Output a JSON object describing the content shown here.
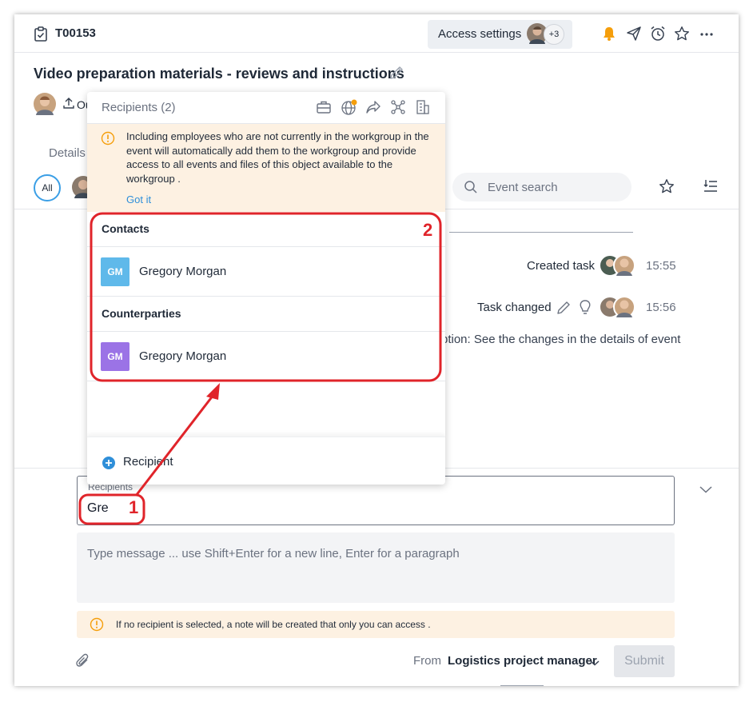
{
  "header": {
    "task_id": "T00153",
    "access_settings_label": "Access settings",
    "access_extra_count": "+3"
  },
  "task": {
    "title": "Video preparation materials - reviews and instructions",
    "owner_text": "Ou",
    "details_tab": "Details"
  },
  "filters": {
    "all_label": "All",
    "search_placeholder": "Event search"
  },
  "events": [
    {
      "label": "Created task",
      "time": "15:55"
    },
    {
      "label": "Task changed",
      "time": "15:56"
    }
  ],
  "event_detail": "ption:  See the changes in the details of event",
  "popup": {
    "title": "Recipients (2)",
    "warning_text": "Including employees who are not currently in the workgroup in the event will automatically add them to the workgroup and provide access to all events and files of this object available to the workgroup .",
    "got_it_label": "Got it",
    "sections": [
      {
        "label": "Contacts",
        "person": {
          "initials": "GM",
          "name": "Gregory Morgan",
          "color": "#5fb9ea"
        }
      },
      {
        "label": "Counterparties",
        "person": {
          "initials": "GM",
          "name": "Gregory Morgan",
          "color": "#9b73e6"
        }
      }
    ],
    "add_recipient_label": "Recipient"
  },
  "compose": {
    "recipients_label": "Recipients",
    "recipients_value": "Gre",
    "message_placeholder": "Type message ... use Shift+Enter for a new line, Enter for a paragraph",
    "note_warning": "If no recipient is selected, a note will be created that only you can access .",
    "from_label": "From",
    "from_value": "Logistics project manager",
    "submit_label": "Submit"
  },
  "annotations": {
    "marker_1": "1",
    "marker_2": "2",
    "color": "#e0242a"
  },
  "colors": {
    "accent": "#3b9fe6",
    "bell": "#f59e0b",
    "warning_bg": "#fdf1e2",
    "link": "#2f8fd9"
  }
}
